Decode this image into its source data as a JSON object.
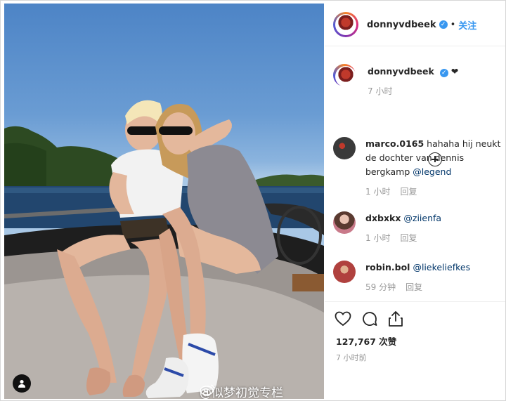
{
  "post": {
    "username": "donnyvdbeek",
    "dot": "•",
    "follow_label": "关注",
    "heart": "❤",
    "caption_time": "7 小时",
    "like_count": "127,767 次赞",
    "post_time": "7 小时前"
  },
  "comments": [
    {
      "user": "marco.0165",
      "text": " hahaha hij neukt de dochter van dennis bergkamp ",
      "mention": "@legend",
      "time": "1 小时",
      "reply": "回复"
    },
    {
      "user": "dxbxkx",
      "text": " ",
      "mention": "@ziienfa",
      "time": "1 小时",
      "reply": "回复"
    },
    {
      "user": "robin.bol",
      "text": " ",
      "mention": "@liekeliefkes",
      "time": "59 分钟",
      "reply": "回复"
    }
  ],
  "watermark": "@似梦初觉专栏",
  "colors": {
    "accent": "#3897f0",
    "mention": "#003569",
    "meta": "#999999"
  },
  "icons": [
    "heart-icon",
    "comment-icon",
    "share-icon",
    "plus-circle-icon",
    "user-tag-icon",
    "verified-icon",
    "weibo-logo-icon"
  ]
}
